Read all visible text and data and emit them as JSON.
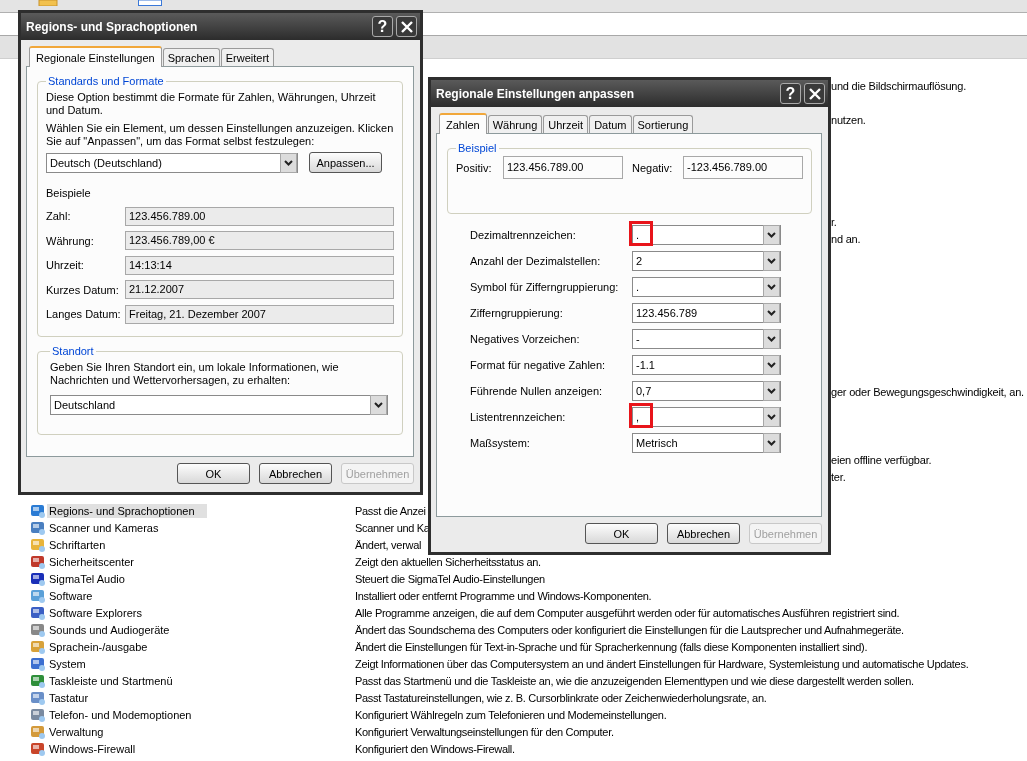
{
  "control_panel": {
    "fragments": [
      "und die Bildschirmauflösung.",
      "nutzen.",
      "r.",
      "nd an.",
      "ger oder Bewegungsgeschwindigkeit, an.",
      "eien offline verfügbar.",
      "ter."
    ],
    "items": [
      {
        "name": "Regions- und Sprachoptionen",
        "description": "Passt die Anzei",
        "selected": true
      },
      {
        "name": "Scanner und Kameras",
        "description": "Scanner und Ka",
        "selected": false
      },
      {
        "name": "Schriftarten",
        "description": "Ändert, verwal",
        "selected": false
      },
      {
        "name": "Sicherheitscenter",
        "description": "Zeigt den aktuellen Sicherheitsstatus an.",
        "selected": false
      },
      {
        "name": "SigmaTel Audio",
        "description": "Steuert die SigmaTel Audio-Einstellungen",
        "selected": false
      },
      {
        "name": "Software",
        "description": "Installiert oder entfernt Programme und Windows-Komponenten.",
        "selected": false
      },
      {
        "name": "Software Explorers",
        "description": "Alle Programme anzeigen, die auf dem Computer ausgeführt werden oder für automatisches Ausführen registriert sind.",
        "selected": false
      },
      {
        "name": "Sounds und Audiogeräte",
        "description": "Ändert das Soundschema des Computers oder konfiguriert die Einstellungen für die Lautsprecher und Aufnahmegeräte.",
        "selected": false
      },
      {
        "name": "Sprachein-/ausgabe",
        "description": "Ändert die Einstellungen für Text-in-Sprache und für Spracherkennung (falls diese Komponenten installiert sind).",
        "selected": false
      },
      {
        "name": "System",
        "description": "Zeigt Informationen über das Computersystem an und ändert Einstellungen für Hardware, Systemleistung und automatische Updates.",
        "selected": false
      },
      {
        "name": "Taskleiste und Startmenü",
        "description": "Passt das Startmenü und die Taskleiste an, wie die anzuzeigenden Elementtypen und wie diese dargestellt werden sollen.",
        "selected": false
      },
      {
        "name": "Tastatur",
        "description": "Passt Tastatureinstellungen, wie z. B. Cursorblinkrate oder Zeichenwiederholungsrate, an.",
        "selected": false
      },
      {
        "name": "Telefon- und Modemoptionen",
        "description": "Konfiguriert Wählregeln zum Telefonieren und Modemeinstellungen.",
        "selected": false
      },
      {
        "name": "Verwaltung",
        "description": "Konfiguriert Verwaltungseinstellungen für den Computer.",
        "selected": false
      },
      {
        "name": "Windows-Firewall",
        "description": "Konfiguriert den Windows-Firewall.",
        "selected": false
      }
    ]
  },
  "regional_dialog": {
    "title": "Regions- und Sprachoptionen",
    "help_button": "?",
    "tabs": [
      {
        "label": "Regionale Einstellungen",
        "selected": true
      },
      {
        "label": "Sprachen",
        "selected": false
      },
      {
        "label": "Erweitert",
        "selected": false
      }
    ],
    "standards_group": {
      "legend": "Standards und Formate",
      "description": "Diese Option bestimmt die Formate für Zahlen, Währungen, Uhrzeit und Datum.",
      "instruction": "Wählen Sie ein Element, um dessen Einstellungen anzuzeigen. Klicken Sie auf \"Anpassen\", um das Format selbst festzulegen:",
      "format_select": "Deutsch (Deutschland)",
      "customize_button": "Anpassen...",
      "examples_heading": "Beispiele",
      "examples": [
        {
          "label": "Zahl:",
          "value": "123.456.789.00"
        },
        {
          "label": "Währung:",
          "value": "123.456.789,00 €"
        },
        {
          "label": "Uhrzeit:",
          "value": "14:13:14"
        },
        {
          "label": "Kurzes Datum:",
          "value": "21.12.2007"
        },
        {
          "label": "Langes Datum:",
          "value": "Freitag, 21. Dezember 2007"
        }
      ]
    },
    "location_group": {
      "legend": "Standort",
      "description": "Geben Sie Ihren Standort ein, um lokale Informationen, wie Nachrichten und Wettervorhersagen, zu erhalten:",
      "location_select": "Deutschland"
    },
    "buttons": [
      {
        "label": "OK",
        "disabled": false
      },
      {
        "label": "Abbrechen",
        "disabled": false
      },
      {
        "label": "Übernehmen",
        "disabled": true
      }
    ]
  },
  "customize_dialog": {
    "title": "Regionale Einstellungen anpassen",
    "help_button": "?",
    "tabs": [
      {
        "label": "Zahlen",
        "selected": true
      },
      {
        "label": "Währung",
        "selected": false
      },
      {
        "label": "Uhrzeit",
        "selected": false
      },
      {
        "label": "Datum",
        "selected": false
      },
      {
        "label": "Sortierung",
        "selected": false
      }
    ],
    "example_group": {
      "legend": "Beispiel",
      "positive_label": "Positiv:",
      "positive_value": "123.456.789.00",
      "negative_label": "Negativ:",
      "negative_value": "-123.456.789.00"
    },
    "settings": [
      {
        "label": "Dezimaltrennzeichen:",
        "value": ".",
        "highlighted": true
      },
      {
        "label": "Anzahl der Dezimalstellen:",
        "value": "2",
        "highlighted": false
      },
      {
        "label": "Symbol für Zifferngruppierung:",
        "value": ".",
        "highlighted": false
      },
      {
        "label": "Zifferngruppierung:",
        "value": "123.456.789",
        "highlighted": false
      },
      {
        "label": "Negatives Vorzeichen:",
        "value": "-",
        "highlighted": false
      },
      {
        "label": "Format für negative Zahlen:",
        "value": "-1.1",
        "highlighted": false
      },
      {
        "label": "Führende Nullen anzeigen:",
        "value": "0,7",
        "highlighted": false
      },
      {
        "label": "Listentrennzeichen:",
        "value": ",",
        "highlighted": true
      },
      {
        "label": "Maßsystem:",
        "value": "Metrisch",
        "highlighted": false
      }
    ],
    "buttons": [
      {
        "label": "OK",
        "disabled": false
      },
      {
        "label": "Abbrechen",
        "disabled": false
      },
      {
        "label": "Übernehmen",
        "disabled": true
      }
    ]
  }
}
